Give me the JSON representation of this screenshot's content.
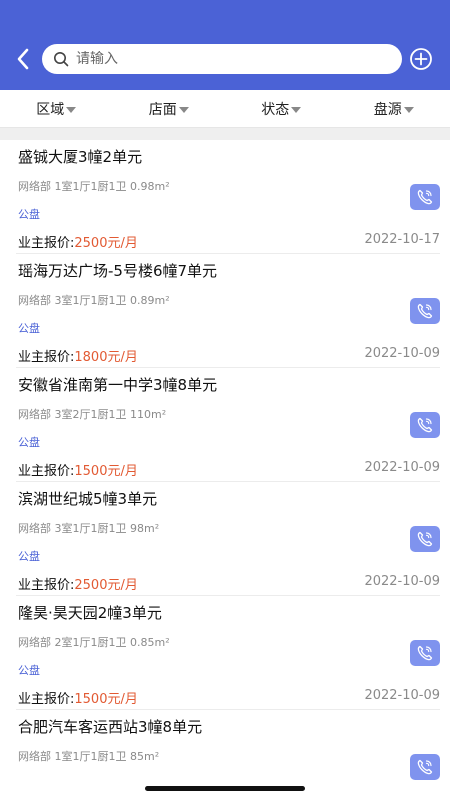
{
  "search": {
    "placeholder": "请输入"
  },
  "filters": [
    {
      "label": "区域"
    },
    {
      "label": "店面"
    },
    {
      "label": "状态"
    },
    {
      "label": "盘源"
    }
  ],
  "listings": [
    {
      "title": "盛铖大厦3幢2单元",
      "meta": "网络部 1室1厅1厨1卫 0.98m²",
      "tag": "公盘",
      "price_label": "业主报价:",
      "price": "2500元/月",
      "date": "2022-10-17"
    },
    {
      "title": "瑶海万达广场-5号楼6幢7单元",
      "meta": "网络部 3室1厅1厨1卫 0.89m²",
      "tag": "公盘",
      "price_label": "业主报价:",
      "price": "1800元/月",
      "date": "2022-10-09"
    },
    {
      "title": "安徽省淮南第一中学3幢8单元",
      "meta": "网络部 3室2厅1厨1卫 110m²",
      "tag": "公盘",
      "price_label": "业主报价:",
      "price": "1500元/月",
      "date": "2022-10-09"
    },
    {
      "title": "滨湖世纪城5幢3单元",
      "meta": "网络部 3室1厅1厨1卫 98m²",
      "tag": "公盘",
      "price_label": "业主报价:",
      "price": "2500元/月",
      "date": "2022-10-09"
    },
    {
      "title": "隆昊·昊天园2幢3单元",
      "meta": "网络部 2室1厅1厨1卫 0.85m²",
      "tag": "公盘",
      "price_label": "业主报价:",
      "price": "1500元/月",
      "date": "2022-10-09"
    },
    {
      "title": "合肥汽车客运西站3幢8单元",
      "meta": "网络部 1室1厅1厨1卫 85m²",
      "tag": "",
      "price_label": "",
      "price": "",
      "date": ""
    }
  ],
  "colors": {
    "header": "#4b62d6",
    "price": "#e25a33",
    "tag": "#4b62d6",
    "call_button": "#7f93ee"
  },
  "icons": {
    "back": "chevron-left-icon",
    "search": "search-icon",
    "add": "plus-circle-icon",
    "call": "phone-icon"
  }
}
